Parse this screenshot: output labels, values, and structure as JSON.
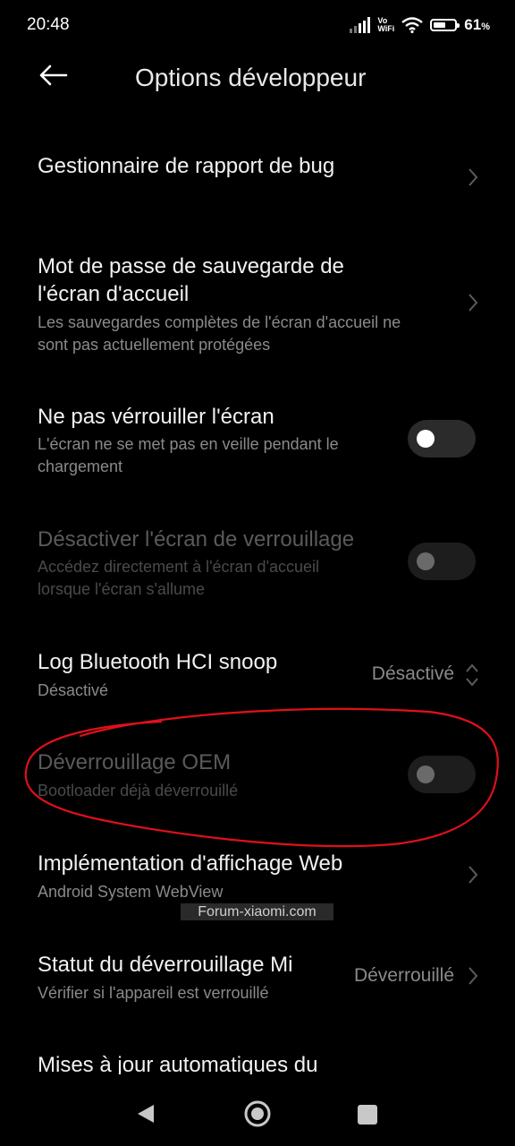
{
  "status": {
    "time": "20:48",
    "vowifi_top": "Vo",
    "vowifi_bottom": "WiFi",
    "battery_percent": "61",
    "battery_percent_sign": "%",
    "battery_level": 0.61
  },
  "header": {
    "title": "Options développeur"
  },
  "items": [
    {
      "title": "Gestionnaire de rapport de bug"
    },
    {
      "title_line1": "Mot de passe de sauvegarde de",
      "title_line2": "l'écran d'accueil",
      "sub_line1": "Les sauvegardes complètes de l'écran d'accueil ne",
      "sub_line2": "sont pas actuellement protégées"
    },
    {
      "title": "Ne pas vérrouiller l'écran",
      "sub_line1": "L'écran ne se met pas en veille pendant le",
      "sub_line2": "chargement",
      "toggle_on": false
    },
    {
      "title": "Désactiver l'écran de verrouillage",
      "sub_line1": "Accédez directement à l'écran d'accueil",
      "sub_line2": "lorsque l'écran s'allume",
      "toggle_on": false,
      "enabled": false
    },
    {
      "title": "Log Bluetooth HCI snoop",
      "sub": "Désactivé",
      "value": "Désactivé"
    },
    {
      "title": "Déverrouillage OEM",
      "sub": "Bootloader déjà déverrouillé",
      "toggle_on": false,
      "enabled": false
    },
    {
      "title": "Implémentation d'affichage Web",
      "sub": "Android System WebView"
    },
    {
      "title": "Statut du déverrouillage Mi",
      "sub": "Vérifier si l'appareil est verrouillé",
      "value": "Déverrouillé"
    },
    {
      "title": "Mises à jour automatiques du"
    }
  ],
  "watermark": "Forum-xiaomi.com",
  "icons": {
    "back": "arrow-left-icon",
    "chevron": "chevron-right-icon",
    "dropdown": "up-down-chevron-icon",
    "nav_back": "triangle-back-icon",
    "nav_home": "circle-home-icon",
    "nav_recent": "square-recents-icon"
  },
  "colors": {
    "background": "#000000",
    "annotation": "#e0101a",
    "accent": "#2f6fe0"
  }
}
